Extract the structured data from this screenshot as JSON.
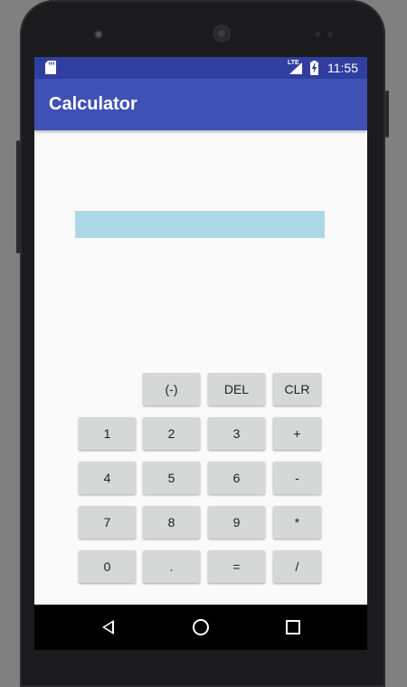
{
  "status_bar": {
    "time": "11:55",
    "network": "LTE"
  },
  "app_bar": {
    "title": "Calculator"
  },
  "display": {
    "value": ""
  },
  "keypad": {
    "row1": [
      "(-)",
      "DEL",
      "CLR"
    ],
    "row2": [
      "1",
      "2",
      "3",
      "+"
    ],
    "row3": [
      "4",
      "5",
      "6",
      "-"
    ],
    "row4": [
      "7",
      "8",
      "9",
      "*"
    ],
    "row5": [
      "0",
      ".",
      "=",
      "/"
    ]
  },
  "colors": {
    "status_bar": "#303f9f",
    "app_bar": "#3f51b5",
    "display_bg": "#add8e6",
    "key_bg": "#d6d7d7",
    "screen_bg": "#fafafa"
  }
}
